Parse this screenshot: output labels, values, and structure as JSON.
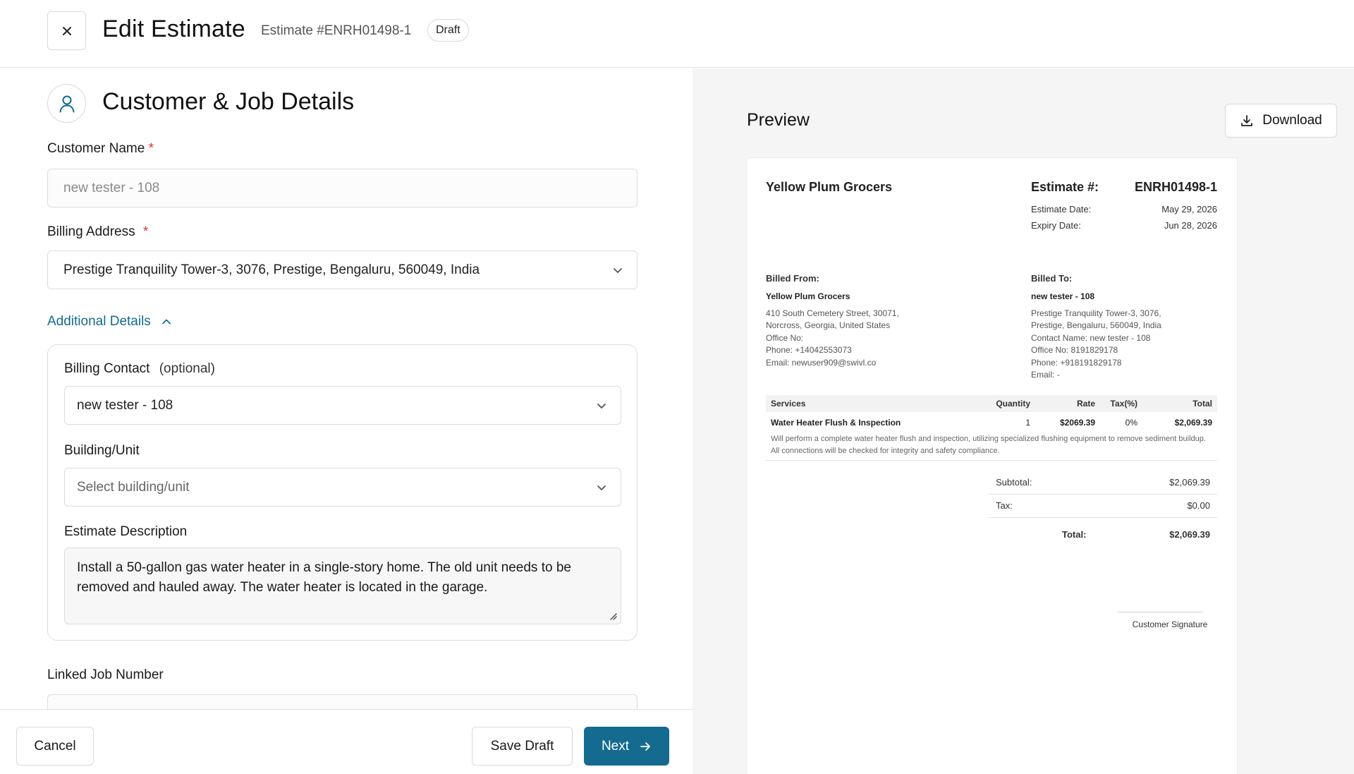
{
  "header": {
    "title": "Edit Estimate",
    "estimate_ref": "Estimate #ENRH01498-1",
    "status_badge": "Draft"
  },
  "form": {
    "section_title": "Customer & Job Details",
    "customer_name": {
      "label": "Customer Name",
      "required_mark": "*",
      "placeholder": "new tester - 108"
    },
    "billing_address": {
      "label": "Billing Address",
      "required_mark": "*",
      "value": "Prestige Tranquility Tower-3, 3076, Prestige, Bengaluru, 560049, India"
    },
    "additional_details_toggle": "Additional Details",
    "billing_contact": {
      "label": "Billing Contact",
      "optional": "(optional)",
      "value": "new tester - 108"
    },
    "building_unit": {
      "label": "Building/Unit",
      "placeholder": "Select building/unit"
    },
    "estimate_description": {
      "label": "Estimate Description",
      "value": "Install a 50-gallon gas water heater in a single-story home. The old unit needs to be removed and hauled away. The water heater is located in the garage."
    },
    "linked_job": {
      "label": "Linked Job Number"
    }
  },
  "footer": {
    "cancel": "Cancel",
    "save_draft": "Save Draft",
    "next": "Next"
  },
  "preview": {
    "title": "Preview",
    "download": "Download",
    "document": {
      "business_name": "Yellow Plum Grocers",
      "estimate_label": "Estimate #:",
      "estimate_number": "ENRH01498-1",
      "estimate_date_label": "Estimate Date:",
      "estimate_date": "May 29, 2026",
      "expiry_date_label": "Expiry Date:",
      "expiry_date": "Jun 28, 2026",
      "billed_from": {
        "heading": "Billed From:",
        "name": "Yellow Plum Grocers",
        "lines": [
          "410 South Cemetery Street, 30071,",
          "Norcross, Georgia, United States",
          "Office No:",
          "Phone: +14042553073",
          "Email: newuser909@swivl.co"
        ]
      },
      "billed_to": {
        "heading": "Billed To:",
        "name": "new tester - 108",
        "lines": [
          "Prestige Tranquility Tower-3, 3076,",
          "Prestige, Bengaluru, 560049, India",
          "Contact Name: new tester - 108",
          "Office No: 8191829178",
          "Phone: +918191829178",
          "Email: -"
        ]
      },
      "table": {
        "headers": [
          "Services",
          "Quantity",
          "Rate",
          "Tax(%)",
          "Total"
        ],
        "rows": [
          {
            "service": "Water Heater Flush & Inspection",
            "quantity": "1",
            "rate": "$2069.39",
            "tax": "0%",
            "total": "$2,069.39",
            "description": "Will perform a complete water heater flush and inspection, utilizing specialized flushing equipment to remove sediment buildup. All connections will be checked for integrity and safety compliance."
          }
        ]
      },
      "subtotal_label": "Subtotal:",
      "subtotal": "$2,069.39",
      "tax_label": "Tax:",
      "tax": "$0.00",
      "total_label": "Total:",
      "total": "$2,069.39",
      "signature_label": "Customer Signature"
    }
  },
  "colors": {
    "accent": "#146b8f",
    "required": "#e03131"
  },
  "icons": {
    "close": "close-icon",
    "section": "user-icon",
    "chevron": "chevron-down-icon",
    "collapse": "chevron-up-icon",
    "download": "download-icon",
    "next": "arrow-right-icon"
  }
}
